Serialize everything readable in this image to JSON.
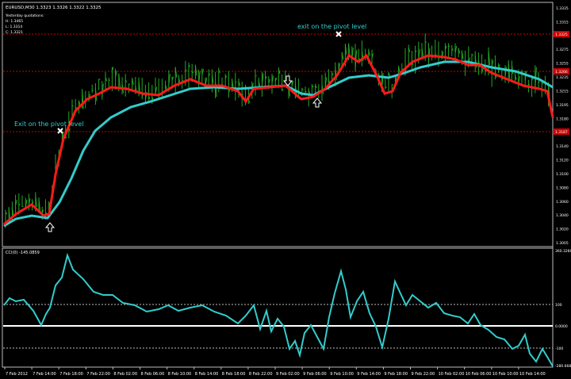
{
  "window": {
    "title": "EURUSD,M30  1.3323 1.3326 1.3322 1.3325"
  },
  "info_panel": {
    "heading": "Yesterday quotations:",
    "lines": [
      "H: 1.3465",
      "L: 1.3314",
      "C: 1.3321"
    ]
  },
  "annotations": {
    "exit_left": "Exit on the pivot level",
    "exit_right": "exit on the pivot level"
  },
  "price_axis": {
    "labels": [
      "1.3335",
      "1.3315",
      "1.3295",
      "1.3275",
      "1.3255",
      "1.3235",
      "1.3215",
      "1.3195",
      "1.3180",
      "1.3160",
      "1.3140",
      "1.3120",
      "1.3100",
      "1.3080",
      "1.3060",
      "1.3040",
      "1.3020",
      "1.3005"
    ],
    "badges": [
      {
        "text": "1.3325",
        "color": "#cc0000"
      },
      {
        "text": "1.3266",
        "color": "#cc0000"
      },
      {
        "text": "1.3187",
        "color": "#cc0000"
      }
    ]
  },
  "indicator": {
    "title": "CCI(0) -145.0859",
    "axis_labels": [
      "360.3280",
      "100",
      "0.0000",
      "-100",
      "-280.6681"
    ]
  },
  "time_axis": {
    "labels": [
      "7 Feb 2012",
      "7 Feb 14:00",
      "7 Feb 18:00",
      "7 Feb 22:00",
      "8 Feb 02:00",
      "8 Feb 06:00",
      "8 Feb 10:00",
      "8 Feb 14:00",
      "8 Feb 18:00",
      "8 Feb 22:00",
      "9 Feb 02:00",
      "9 Feb 06:00",
      "9 Feb 10:00",
      "9 Feb 14:00",
      "9 Feb 18:00",
      "9 Feb 22:00",
      "10 Feb 02:00",
      "10 Feb 06:00",
      "10 Feb 10:00",
      "10 Feb 14:00"
    ]
  },
  "colors": {
    "background": "#000000",
    "bars": "#22aa22",
    "fast_ma": "#ff1a1a",
    "slow_ma": "#33cccc",
    "cci_line": "#33cccc",
    "pivot_line": "#cc0000",
    "zero_line": "#ffffff",
    "frame": "#bbbbbb"
  }
}
